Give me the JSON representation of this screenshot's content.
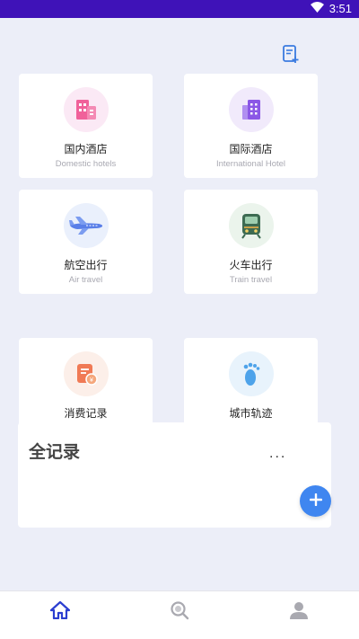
{
  "status_bar": {
    "time": "3:51",
    "wifi_icon": "wifi-icon"
  },
  "top_action": {
    "icon": "document-add-icon"
  },
  "cards": [
    {
      "id": "domestic",
      "title": "国内酒店",
      "subtitle": "Domestic hotels",
      "icon": "hotel-building-icon",
      "icon_bg": "#fbe9f5",
      "accent": "#f0619a"
    },
    {
      "id": "international",
      "title": "国际酒店",
      "subtitle": "International Hotel",
      "icon": "office-building-icon",
      "icon_bg": "#f1eafb",
      "accent": "#8b57e6"
    },
    {
      "id": "air",
      "title": "航空出行",
      "subtitle": "Air travel",
      "icon": "airplane-icon",
      "icon_bg": "#eaf0fc",
      "accent": "#5a7fe8"
    },
    {
      "id": "train",
      "title": "火车出行",
      "subtitle": "Train travel",
      "icon": "train-icon",
      "icon_bg": "#ebf4ec",
      "accent": "#3d6b52"
    },
    {
      "id": "expense",
      "title": "消费记录",
      "subtitle": "",
      "icon": "receipt-icon",
      "icon_bg": "#fcefe9",
      "accent": "#f07a55"
    },
    {
      "id": "city",
      "title": "城市轨迹",
      "subtitle": "",
      "icon": "footprint-icon",
      "icon_bg": "#e8f3fc",
      "accent": "#4ea3ea"
    }
  ],
  "sheet": {
    "title": "全记录",
    "more": "...",
    "fab_icon": "plus-icon"
  },
  "bottom_nav": [
    {
      "id": "home",
      "icon": "home-icon",
      "active": true
    },
    {
      "id": "search",
      "icon": "search-icon",
      "active": false
    },
    {
      "id": "profile",
      "icon": "user-icon",
      "active": false
    }
  ],
  "colors": {
    "status_bar": "#3f12b8",
    "active_nav": "#2b3ed0",
    "inactive_nav": "#a9a9b0",
    "fab": "#3f86f0"
  }
}
